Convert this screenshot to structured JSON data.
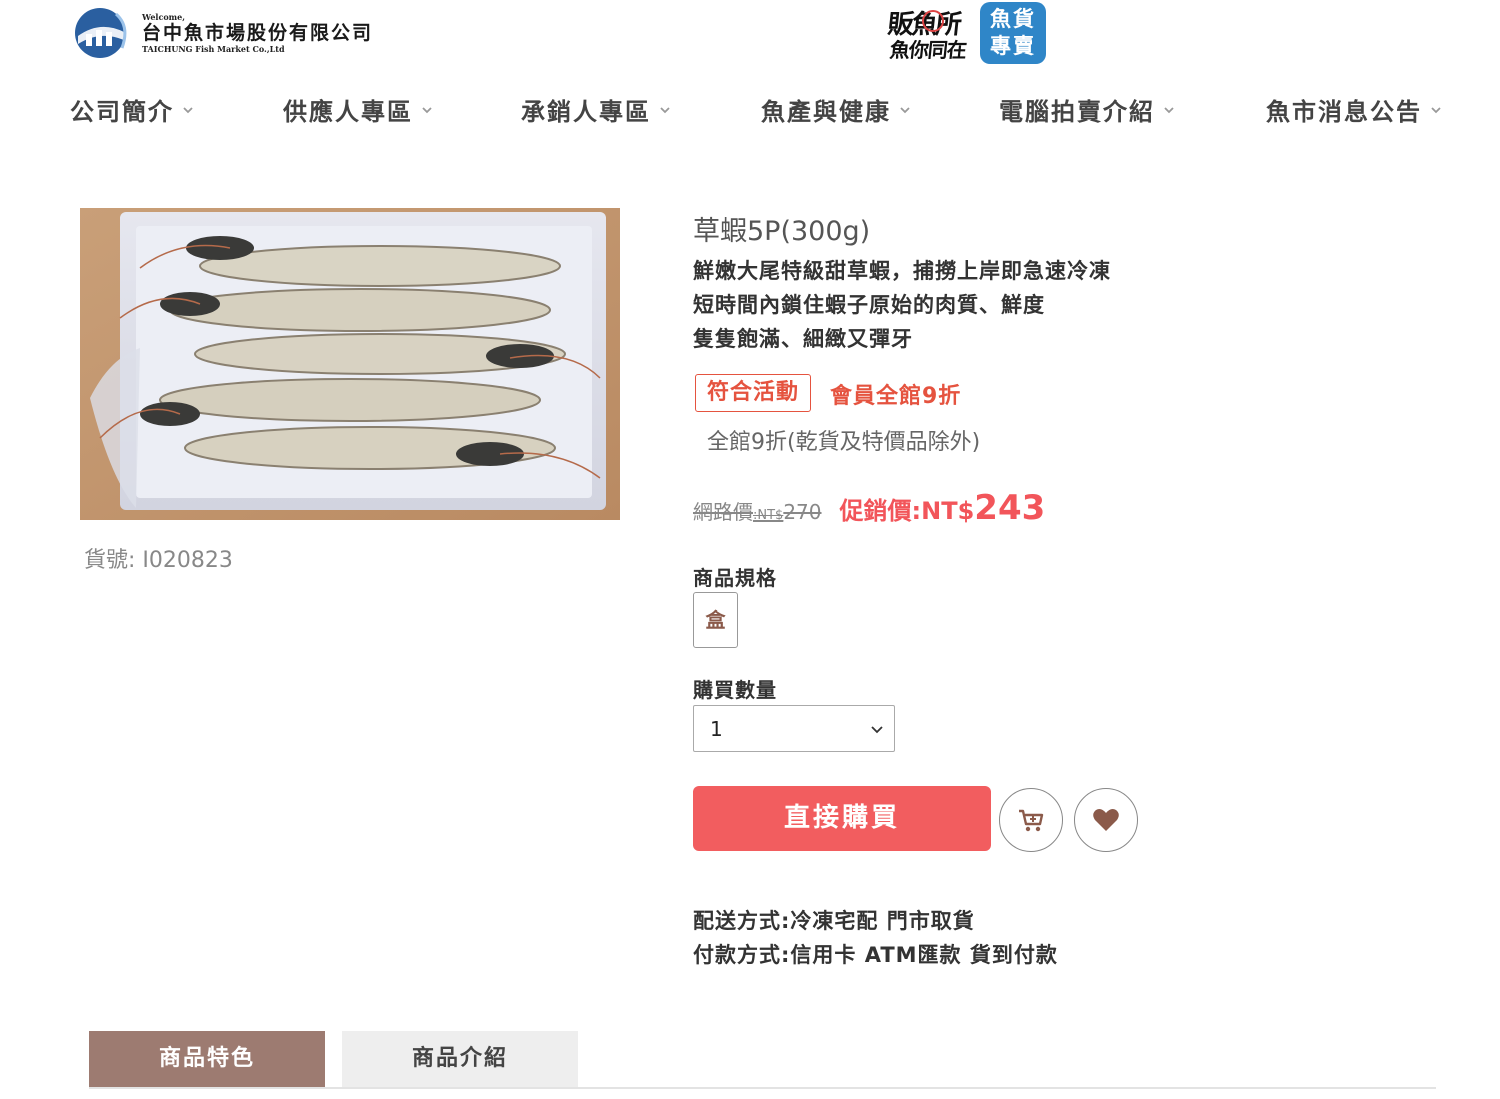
{
  "header": {
    "logo_welcome": "Welcome,",
    "logo_cn": "台中魚市場股份有限公司",
    "logo_en": "TAICHUNG Fish Market Co.,Ltd",
    "brand_calli_top": "販魚所",
    "brand_calli_bottom": "魚你同在",
    "brand_box_line1": "魚貨",
    "brand_box_line2": "專賣"
  },
  "nav": {
    "items": [
      {
        "label": "公司簡介"
      },
      {
        "label": "供應人專區"
      },
      {
        "label": "承銷人專區"
      },
      {
        "label": "魚產與健康"
      },
      {
        "label": "電腦拍賣介紹"
      },
      {
        "label": "魚市消息公告"
      }
    ]
  },
  "product": {
    "title": "草蝦5P(300g)",
    "sku": "貨號: I020823",
    "desc": [
      "鮮嫩大尾特級甜草蝦，捕撈上岸即急速冷凍",
      "短時間內鎖住蝦子原始的肉質、鮮度",
      "隻隻飽滿、細緻又彈牙"
    ],
    "promo_tag": "符合活動",
    "promo_member": "會員全館9折",
    "promo_note": "全館9折(乾貨及特價品除外)",
    "list_price_label": "網路價",
    "list_price_currency": ":NT$",
    "list_price_value": "270",
    "sale_label": "促銷價:NT$",
    "sale_value": "243",
    "spec_label": "商品規格",
    "spec_option": "盒",
    "qty_label": "購買數量",
    "qty_value": "1",
    "buy_label": "直接購買",
    "shipping": "配送方式:冷凍宅配 門市取貨",
    "payment": "付款方式:信用卡 ATM匯款 貨到付款"
  },
  "tabs": [
    {
      "label": "商品特色",
      "active": true
    },
    {
      "label": "商品介紹",
      "active": false
    }
  ],
  "icons": {
    "nav_chevron": "chevron-down-icon",
    "cart": "cart-icon",
    "wishlist": "heart-icon"
  },
  "colors": {
    "accent_red": "#f25d5f",
    "promo_red": "#e5533f",
    "tab_active": "#9d7b71",
    "brand_blue": "#2f86c8"
  }
}
